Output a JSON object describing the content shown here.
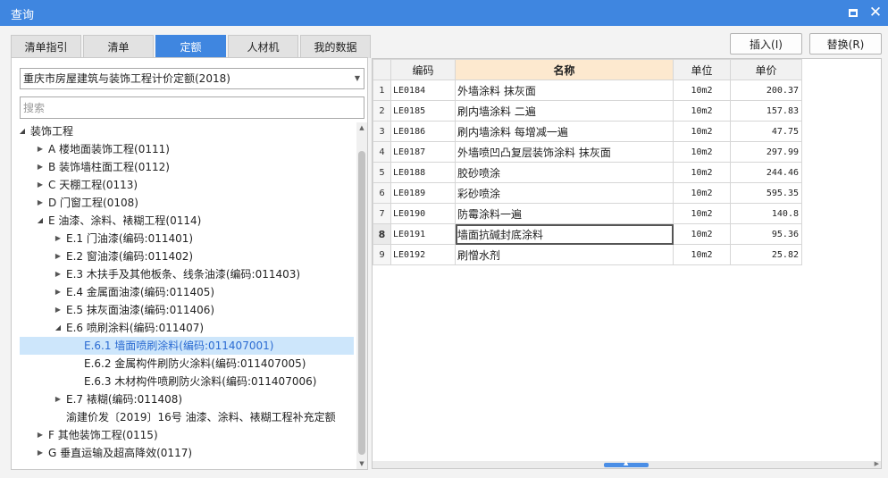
{
  "window": {
    "title": "查询",
    "maximize_icon": "maximize-icon",
    "close_icon": "close-icon",
    "close_glyph": "✕"
  },
  "tabs": [
    {
      "label": "清单指引",
      "active": false
    },
    {
      "label": "清单",
      "active": false
    },
    {
      "label": "定额",
      "active": true
    },
    {
      "label": "人材机",
      "active": false
    },
    {
      "label": "我的数据",
      "active": false
    }
  ],
  "toolbar": {
    "insert_label": "插入(I)",
    "replace_label": "替换(R)"
  },
  "library_select": {
    "value": "重庆市房屋建筑与装饰工程计价定额(2018)"
  },
  "search": {
    "placeholder": "搜索",
    "value": ""
  },
  "tree": [
    {
      "label": "装饰工程",
      "level": 0,
      "state": "open",
      "selected": false
    },
    {
      "label": "A 楼地面装饰工程(0111)",
      "level": 1,
      "state": "closed",
      "selected": false
    },
    {
      "label": "B 装饰墙柱面工程(0112)",
      "level": 1,
      "state": "closed",
      "selected": false
    },
    {
      "label": "C 天棚工程(0113)",
      "level": 1,
      "state": "closed",
      "selected": false
    },
    {
      "label": "D 门窗工程(0108)",
      "level": 1,
      "state": "closed",
      "selected": false
    },
    {
      "label": "E 油漆、涂料、裱糊工程(0114)",
      "level": 1,
      "state": "open",
      "selected": false
    },
    {
      "label": "E.1 门油漆(编码:011401)",
      "level": 2,
      "state": "closed",
      "selected": false
    },
    {
      "label": "E.2 窗油漆(编码:011402)",
      "level": 2,
      "state": "closed",
      "selected": false
    },
    {
      "label": "E.3 木扶手及其他板条、线条油漆(编码:011403)",
      "level": 2,
      "state": "closed",
      "selected": false
    },
    {
      "label": "E.4 金属面油漆(编码:011405)",
      "level": 2,
      "state": "closed",
      "selected": false
    },
    {
      "label": "E.5 抹灰面油漆(编码:011406)",
      "level": 2,
      "state": "closed",
      "selected": false
    },
    {
      "label": "E.6 喷刷涂料(编码:011407)",
      "level": 2,
      "state": "open",
      "selected": false
    },
    {
      "label": "E.6.1 墙面喷刷涂料(编码:011407001)",
      "level": 3,
      "state": "leaf",
      "selected": true
    },
    {
      "label": "E.6.2 金属构件刷防火涂料(编码:011407005)",
      "level": 3,
      "state": "leaf",
      "selected": false
    },
    {
      "label": "E.6.3 木材构件喷刷防火涂料(编码:011407006)",
      "level": 3,
      "state": "leaf",
      "selected": false
    },
    {
      "label": "E.7 裱糊(编码:011408)",
      "level": 2,
      "state": "closed",
      "selected": false
    },
    {
      "label": "渝建价发〔2019〕16号 油漆、涂料、裱糊工程补充定额",
      "level": 2,
      "state": "leaf",
      "selected": false
    },
    {
      "label": "F 其他装饰工程(0115)",
      "level": 1,
      "state": "closed",
      "selected": false
    },
    {
      "label": "G 垂直运输及超高降效(0117)",
      "level": 1,
      "state": "closed",
      "selected": false
    }
  ],
  "table": {
    "columns": {
      "code": "编码",
      "name": "名称",
      "unit": "单位",
      "price": "单价"
    },
    "rows": [
      {
        "num": "1",
        "code": "LE0184",
        "name": "外墙涂料 抹灰面",
        "unit": "10m2",
        "price": "200.37"
      },
      {
        "num": "2",
        "code": "LE0185",
        "name": "刷内墙涂料 二遍",
        "unit": "10m2",
        "price": "157.83"
      },
      {
        "num": "3",
        "code": "LE0186",
        "name": "刷内墙涂料 每增减一遍",
        "unit": "10m2",
        "price": "47.75"
      },
      {
        "num": "4",
        "code": "LE0187",
        "name": "外墙喷凹凸复层装饰涂料 抹灰面",
        "unit": "10m2",
        "price": "297.99"
      },
      {
        "num": "5",
        "code": "LE0188",
        "name": "胶砂喷涂",
        "unit": "10m2",
        "price": "244.46"
      },
      {
        "num": "6",
        "code": "LE0189",
        "name": "彩砂喷涂",
        "unit": "10m2",
        "price": "595.35"
      },
      {
        "num": "7",
        "code": "LE0190",
        "name": "防霉涂料一遍",
        "unit": "10m2",
        "price": "140.8"
      },
      {
        "num": "8",
        "code": "LE0191",
        "name": "墙面抗碱封底涂料",
        "unit": "10m2",
        "price": "95.36"
      },
      {
        "num": "9",
        "code": "LE0192",
        "name": "刷憎水剂",
        "unit": "10m2",
        "price": "25.82"
      }
    ],
    "current_row": "8"
  },
  "colors": {
    "accent": "#3f86e0",
    "selected_bg": "#cde6fb",
    "selected_text": "#2a6bd2",
    "header_name_bg": "#fde9cf"
  }
}
